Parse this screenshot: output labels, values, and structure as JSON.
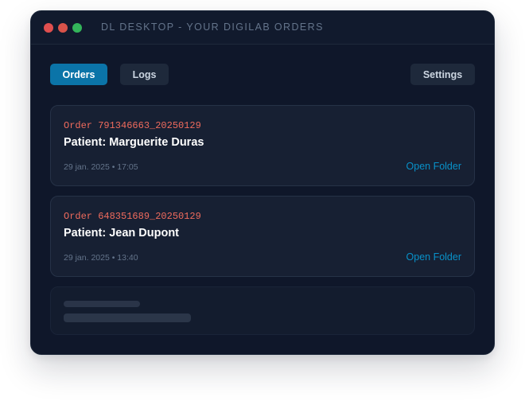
{
  "window": {
    "title": "DL DESKTOP - YOUR DIGILAB ORDERS"
  },
  "toolbar": {
    "orders_label": "Orders",
    "logs_label": "Logs",
    "settings_label": "Settings",
    "active_tab": "Orders"
  },
  "orders": [
    {
      "order_id": "Order 791346663_20250129",
      "patient": "Patient: Marguerite Duras",
      "datetime": "29 jan. 2025 • 17:05",
      "action": "Open Folder"
    },
    {
      "order_id": "Order 648351689_20250129",
      "patient": "Patient: Jean Dupont",
      "datetime": "29 jan. 2025 • 13:40",
      "action": "Open Folder"
    }
  ],
  "colors": {
    "background": "#0f172a",
    "card": "#172033",
    "accent": "#0b74a8",
    "order_id": "#f06b5d",
    "link": "#0891c9"
  }
}
